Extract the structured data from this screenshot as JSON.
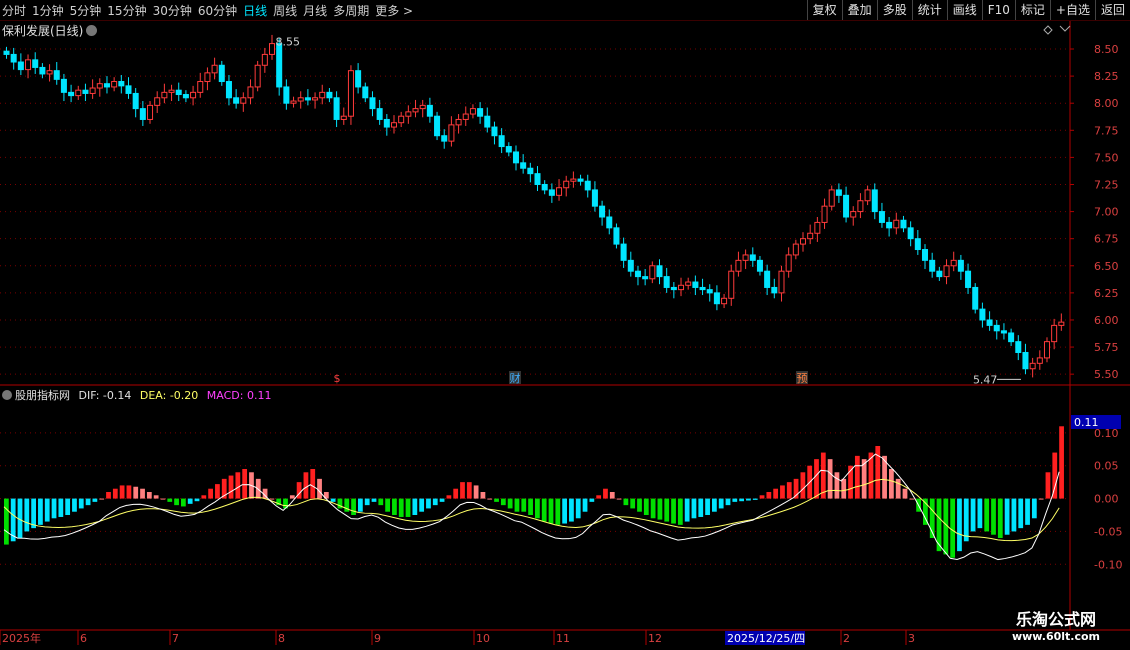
{
  "toolbar": {
    "periods": [
      "分时",
      "1分钟",
      "5分钟",
      "15分钟",
      "30分钟",
      "60分钟",
      "日线",
      "周线",
      "月线",
      "多周期",
      "更多 >"
    ],
    "active_period": "日线",
    "buttons": [
      "复权",
      "叠加",
      "多股",
      "统计",
      "画线",
      "F10",
      "标记",
      "+自选",
      "返回"
    ]
  },
  "main_title": "保利发展(日线)",
  "indicator": {
    "name": "股朋指标网",
    "dif_label": "DIF: -0.14",
    "dea_label": "DEA: -0.20",
    "macd_label": "MACD: 0.11",
    "current_value_tag": "0.11"
  },
  "price_axis_labels": [
    "8.50",
    "8.25",
    "8.00",
    "7.75",
    "7.50",
    "7.25",
    "7.00",
    "6.75",
    "6.50",
    "6.25",
    "6.00",
    "5.75",
    "5.50"
  ],
  "macd_axis_labels": [
    "0.10",
    "0.05",
    "0.00",
    "-0.05",
    "-0.10"
  ],
  "annotations": {
    "high_label": "8.55",
    "low_label": "5.47",
    "markers": [
      "$",
      "财",
      "预"
    ]
  },
  "date_axis": {
    "labels": [
      "2025年",
      "6",
      "7",
      "8",
      "9",
      "10",
      "11",
      "12",
      "2025/12/25/四",
      "2",
      "3"
    ]
  },
  "watermark": {
    "line1": "乐淘公式网",
    "line2": "www.60lt.com"
  },
  "colors": {
    "up": "#ff3b3b",
    "down": "#00e5ff",
    "macd_pos_a": "#ff2020",
    "macd_pos_b": "#ff8080",
    "macd_neg_a": "#00e000",
    "macd_neg_b": "#00e5ff",
    "grid": "#7a0000",
    "dea": "#ffff66",
    "dif": "#ffffff"
  },
  "chart_data": [
    {
      "type": "candlestick",
      "title": "保利发展(日线)",
      "ylim": [
        5.4,
        8.62
      ],
      "y_ticks": [
        8.5,
        8.25,
        8.0,
        7.75,
        7.5,
        7.25,
        7.0,
        6.75,
        6.5,
        6.25,
        6.0,
        5.75,
        5.5
      ],
      "annotated_high": 8.55,
      "annotated_low": 5.47,
      "closes": [
        8.45,
        8.38,
        8.31,
        8.4,
        8.33,
        8.27,
        8.3,
        8.22,
        8.1,
        8.07,
        8.12,
        8.09,
        8.14,
        8.18,
        8.15,
        8.2,
        8.16,
        8.09,
        7.95,
        7.85,
        7.98,
        8.05,
        8.1,
        8.12,
        8.08,
        8.05,
        8.1,
        8.2,
        8.28,
        8.35,
        8.2,
        8.05,
        8.0,
        8.05,
        8.15,
        8.35,
        8.45,
        8.55,
        8.15,
        8.0,
        8.02,
        8.05,
        8.03,
        8.05,
        8.1,
        8.05,
        7.85,
        7.88,
        8.3,
        8.15,
        8.05,
        7.95,
        7.85,
        7.78,
        7.82,
        7.88,
        7.92,
        7.95,
        7.98,
        7.88,
        7.7,
        7.65,
        7.8,
        7.85,
        7.9,
        7.95,
        7.88,
        7.78,
        7.7,
        7.6,
        7.55,
        7.45,
        7.4,
        7.35,
        7.25,
        7.2,
        7.15,
        7.22,
        7.28,
        7.3,
        7.28,
        7.2,
        7.05,
        6.95,
        6.85,
        6.7,
        6.55,
        6.45,
        6.4,
        6.38,
        6.5,
        6.4,
        6.3,
        6.28,
        6.32,
        6.35,
        6.3,
        6.28,
        6.25,
        6.15,
        6.2,
        6.45,
        6.55,
        6.6,
        6.55,
        6.45,
        6.3,
        6.25,
        6.45,
        6.6,
        6.7,
        6.75,
        6.8,
        6.9,
        7.05,
        7.2,
        7.15,
        6.95,
        7.0,
        7.1,
        7.2,
        7.0,
        6.9,
        6.85,
        6.92,
        6.85,
        6.75,
        6.65,
        6.55,
        6.45,
        6.4,
        6.5,
        6.55,
        6.45,
        6.3,
        6.1,
        6.0,
        5.95,
        5.9,
        5.88,
        5.8,
        5.7,
        5.55,
        5.6,
        5.65,
        5.8,
        5.95,
        5.98
      ]
    },
    {
      "type": "bar",
      "title": "股朋指标网",
      "series_labels": [
        "DIF",
        "DEA",
        "MACD"
      ],
      "ylim": [
        -0.2,
        0.15
      ],
      "y_ticks": [
        0.1,
        0.05,
        0.0,
        -0.05,
        -0.1
      ],
      "macd": [
        -0.07,
        -0.065,
        -0.06,
        -0.05,
        -0.045,
        -0.04,
        -0.035,
        -0.03,
        -0.028,
        -0.025,
        -0.02,
        -0.015,
        -0.01,
        -0.005,
        0.0,
        0.01,
        0.015,
        0.02,
        0.02,
        0.018,
        0.015,
        0.01,
        0.005,
        0.0,
        -0.005,
        -0.01,
        -0.012,
        -0.008,
        -0.004,
        0.005,
        0.015,
        0.022,
        0.03,
        0.035,
        0.04,
        0.045,
        0.04,
        0.03,
        0.015,
        0.0,
        -0.01,
        -0.015,
        0.005,
        0.025,
        0.04,
        0.045,
        0.03,
        0.01,
        -0.005,
        -0.015,
        -0.02,
        -0.025,
        -0.02,
        -0.01,
        -0.005,
        -0.01,
        -0.02,
        -0.025,
        -0.028,
        -0.028,
        -0.025,
        -0.02,
        -0.015,
        -0.01,
        -0.005,
        0.005,
        0.015,
        0.025,
        0.025,
        0.02,
        0.01,
        0.0,
        -0.005,
        -0.01,
        -0.015,
        -0.02,
        -0.02,
        -0.025,
        -0.03,
        -0.035,
        -0.038,
        -0.04,
        -0.038,
        -0.035,
        -0.03,
        -0.02,
        -0.005,
        0.005,
        0.015,
        0.01,
        0.0,
        -0.01,
        -0.015,
        -0.02,
        -0.025,
        -0.03,
        -0.032,
        -0.035,
        -0.038,
        -0.04,
        -0.035,
        -0.03,
        -0.028,
        -0.025,
        -0.02,
        -0.015,
        -0.01,
        -0.005,
        -0.004,
        -0.003,
        -0.002,
        0.005,
        0.01,
        0.015,
        0.02,
        0.025,
        0.03,
        0.04,
        0.05,
        0.06,
        0.07,
        0.06,
        0.04,
        0.03,
        0.05,
        0.065,
        0.06,
        0.07,
        0.08,
        0.065,
        0.045,
        0.03,
        0.015,
        0.0,
        -0.02,
        -0.04,
        -0.06,
        -0.08,
        -0.085,
        -0.09,
        -0.08,
        -0.065,
        -0.05,
        -0.045,
        -0.05,
        -0.055,
        -0.06,
        -0.055,
        -0.05,
        -0.045,
        -0.04,
        -0.03,
        0.0,
        0.04,
        0.07,
        0.11
      ]
    }
  ]
}
